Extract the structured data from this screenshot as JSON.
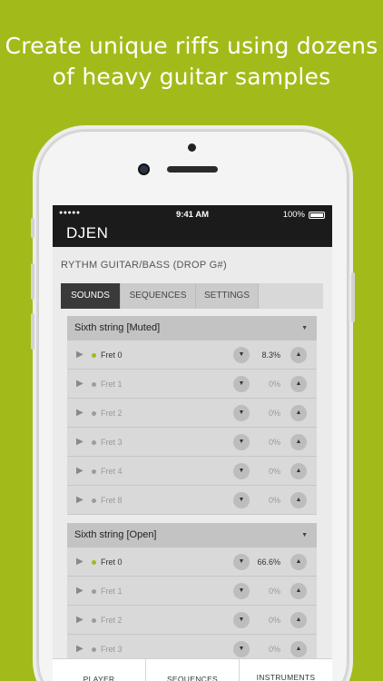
{
  "headline": {
    "line1": "Create unique riffs using dozens",
    "line2": "of heavy guitar samples"
  },
  "statusbar": {
    "signal": "●●●●●",
    "time": "9:41 AM",
    "battery": "100%"
  },
  "app": {
    "title": "DJEN",
    "subtitle": "RYTHM GUITAR/BASS (DROP G#)"
  },
  "tabs": [
    {
      "label": "SOUNDS",
      "active": true
    },
    {
      "label": "SEQUENCES",
      "active": false
    },
    {
      "label": "SETTINGS",
      "active": false
    }
  ],
  "groups": [
    {
      "title": "Sixth string [Muted]",
      "rows": [
        {
          "label": "Fret 0",
          "pct": "8.3%"
        },
        {
          "label": "Fret 1",
          "pct": "0%"
        },
        {
          "label": "Fret 2",
          "pct": "0%"
        },
        {
          "label": "Fret 3",
          "pct": "0%"
        },
        {
          "label": "Fret 4",
          "pct": "0%"
        },
        {
          "label": "Fret 8",
          "pct": "0%"
        }
      ]
    },
    {
      "title": "Sixth string [Open]",
      "rows": [
        {
          "label": "Fret 0",
          "pct": "66.6%"
        },
        {
          "label": "Fret 1",
          "pct": "0%"
        },
        {
          "label": "Fret 2",
          "pct": "0%"
        },
        {
          "label": "Fret 3",
          "pct": "0%"
        }
      ]
    }
  ],
  "icons": {
    "play": "▶",
    "down": "▼",
    "up": "▲",
    "caret": "▼"
  },
  "colors": {
    "background": "#a3bb1a",
    "accent_dot": "#9bbc1c",
    "appbar": "#1b1b1b"
  },
  "bottom_nav": {
    "player": "PLAYER",
    "sequences": "SEQUENCES",
    "instruments": "INSTRUMENTS"
  }
}
